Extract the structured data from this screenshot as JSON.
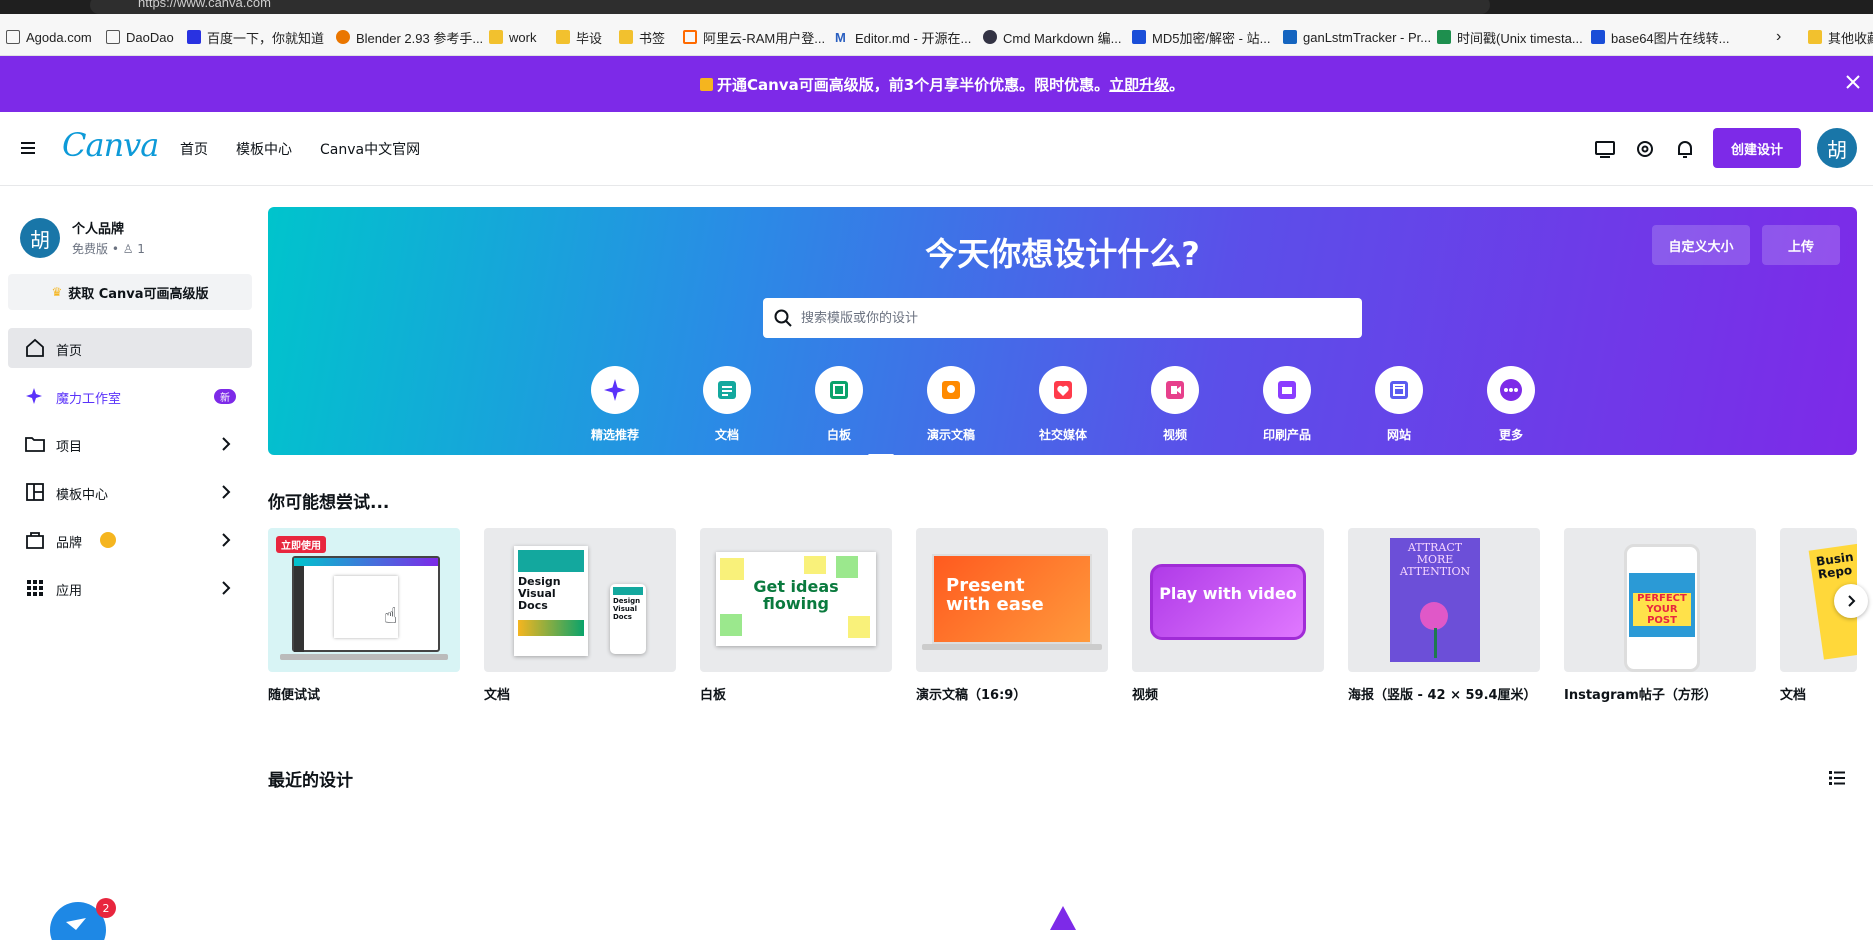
{
  "browser": {
    "url": "https://www.canva.com",
    "bookmarks": [
      "Agoda.com",
      "DaoDao",
      "百度一下，你就知道",
      "Blender 2.93 参考手...",
      "work",
      "毕设",
      "书签",
      "阿里云-RAM用户登...",
      "Editor.md - 开源在...",
      "Cmd Markdown 编...",
      "MD5加密/解密 - 站...",
      "ganLstmTracker - Pr...",
      "时间戳(Unix timesta...",
      "base64图片在线转...",
      "其他收藏"
    ]
  },
  "promo": {
    "text": "开通Canva可画高级版，前3个月享半价优惠。限时优惠。",
    "link": "立即升级",
    "end": "。"
  },
  "header": {
    "logo": "Canva",
    "nav": [
      "首页",
      "模板中心",
      "Canva中文官网"
    ],
    "create_button": "创建设计",
    "avatar": "胡"
  },
  "sidebar": {
    "avatar": "胡",
    "brand_name": "个人品牌",
    "brand_plan": "免费版 • ♙ 1",
    "upgrade": "获取 Canva可画高级版",
    "items": {
      "home": "首页",
      "magic": "魔力工作室",
      "magic_badge": "新",
      "projects": "项目",
      "templates": "模板中心",
      "brand": "品牌",
      "apps": "应用"
    }
  },
  "hero": {
    "title": "今天你想设计什么?",
    "custom_size": "自定义大小",
    "upload": "上传",
    "search_placeholder": "搜索模版或你的设计",
    "categories": [
      "精选推荐",
      "文档",
      "白板",
      "演示文稿",
      "社交媒体",
      "视频",
      "印刷产品",
      "网站",
      "更多"
    ]
  },
  "try_section": {
    "title": "你可能想尝试...",
    "badge": "立即使用",
    "cards": [
      "随便试试",
      "文档",
      "白板",
      "演示文稿（16:9）",
      "视频",
      "海报（竖版 - 42 × 59.4厘米）",
      "Instagram帖子（方形）",
      "文档"
    ],
    "thumb_text": {
      "doc": "Design Visual Docs",
      "doc_small": "Design Visual Docs",
      "whiteboard": "Get ideas flowing",
      "presentation": "Present with ease",
      "video": "Play with video",
      "poster": "ATTRACT MORE ATTENTION",
      "instagram": "PERFECT YOUR POST",
      "doc2": "Busin Repo"
    }
  },
  "recent": {
    "title": "最近的设计",
    "notification_count": "2"
  },
  "colors": {
    "brand_purple": "#7d2ae8",
    "canva_blue": "#0d9ad8"
  }
}
